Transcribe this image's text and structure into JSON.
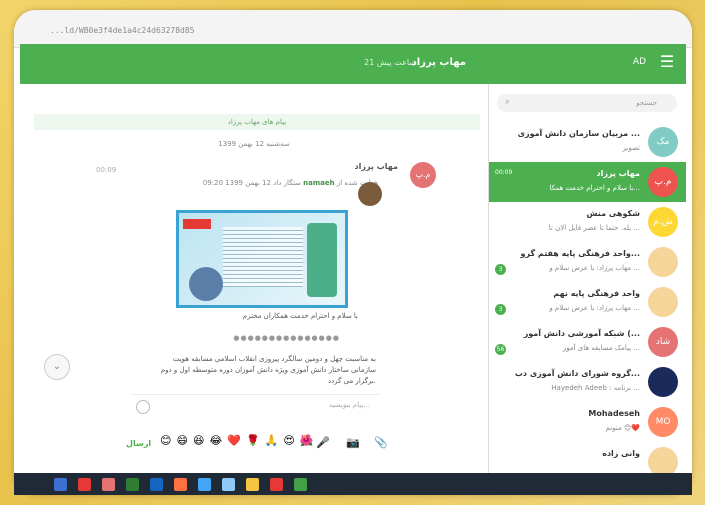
{
  "browser": {
    "url": "...ld/WB0e3f4de1a4c24d63278d85"
  },
  "header": {
    "title": "مهاب پرزاد",
    "subtitle": "21 ساعت پیش",
    "ad_label": "AD"
  },
  "chat": {
    "pinned": "پیام های مهاب پرزاد",
    "date_chip": "سه‌شنبه 12 بهمن 1399",
    "sender": "مهاب پرزاد",
    "sender_initials": "م.پ",
    "time": "00:09",
    "forward_line": "هدایت شده از",
    "forward_name": "namaeh",
    "forward_tail": "ستگار داد 12 بهمن 1399 09:20",
    "caption": "با سلام و احترام خدمت همکاران محترم",
    "separator": "●●●●●●●●●●●●●●●",
    "body": "به مناسبت چهل و دومین سالگرد پیروزی انقلاب اسلامی مسابقه هویت سازمانی ساختار دانش آموزی ویژه دانش آموزان دوره متوسطه اول و دوم برگزار می گردد.",
    "composer_placeholder": "پیام بنویسید...",
    "send_label": "ارسال",
    "emojis": [
      "😊",
      "😄",
      "😆",
      "😂",
      "❤️",
      "🌹",
      "🙏",
      "😍",
      "🌺"
    ]
  },
  "sidebar": {
    "search_placeholder": "جستجو",
    "chats": [
      {
        "name": "مربیان سازمان دانش آموزی ...",
        "last": "تصویر",
        "time": "",
        "initials": "مک",
        "color": "#80cbc4",
        "badge": "",
        "active": false
      },
      {
        "name": "مهاب پرزاد",
        "last": "با سلام و احترام خدمت همکا...",
        "time": "00:09",
        "initials": "م.پ",
        "color": "#ef5350",
        "badge": "",
        "active": true
      },
      {
        "name": "شکوهی منش",
        "last": "بله. حتما تا عصر فایل الان تا ...",
        "time": "",
        "initials": "ش.م",
        "color": "#fdd835",
        "badge": "",
        "active": false
      },
      {
        "name": "واحد فرهنگی پایه هفتم گرو...",
        "last": "مهاب پرزاد: با عرض سلام و ...",
        "time": "",
        "initials": "",
        "color": "#f5d59a",
        "badge": "3",
        "active": false
      },
      {
        "name": "واحد فرهنگی پایه نهم",
        "last": "مهاب پرزاد: با عرض سلام و ...",
        "time": "",
        "initials": "",
        "color": "#f5d59a",
        "badge": "3",
        "active": false
      },
      {
        "name": "شبکه آموزشی دانش آموز (...",
        "last": "پیامک مسابقه های آموز ...",
        "time": "",
        "initials": "شاد",
        "color": "#e57373",
        "badge": "56",
        "active": false
      },
      {
        "name": "گروه شورای دانش آموزی دب...",
        "last": "Hayedeh Adeeb : برنامه ...",
        "time": "",
        "initials": "",
        "color": "#1a2a5a",
        "badge": "",
        "active": false
      },
      {
        "name": "Mohadeseh",
        "last": "منونم 😊❤️",
        "time": "",
        "initials": "MO",
        "color": "#ff8a65",
        "badge": "",
        "active": false
      },
      {
        "name": "وانی زاده",
        "last": "",
        "time": "",
        "initials": "",
        "color": "#f5d59a",
        "badge": "",
        "active": false
      }
    ]
  },
  "taskbar": {
    "colors": [
      "#3d6fd1",
      "#e53935",
      "#e57373",
      "#2e7d32",
      "#1565c0",
      "#ff7043",
      "#42a5f5",
      "#90caf9",
      "#f5c542",
      "#e53935",
      "#43a047"
    ]
  }
}
